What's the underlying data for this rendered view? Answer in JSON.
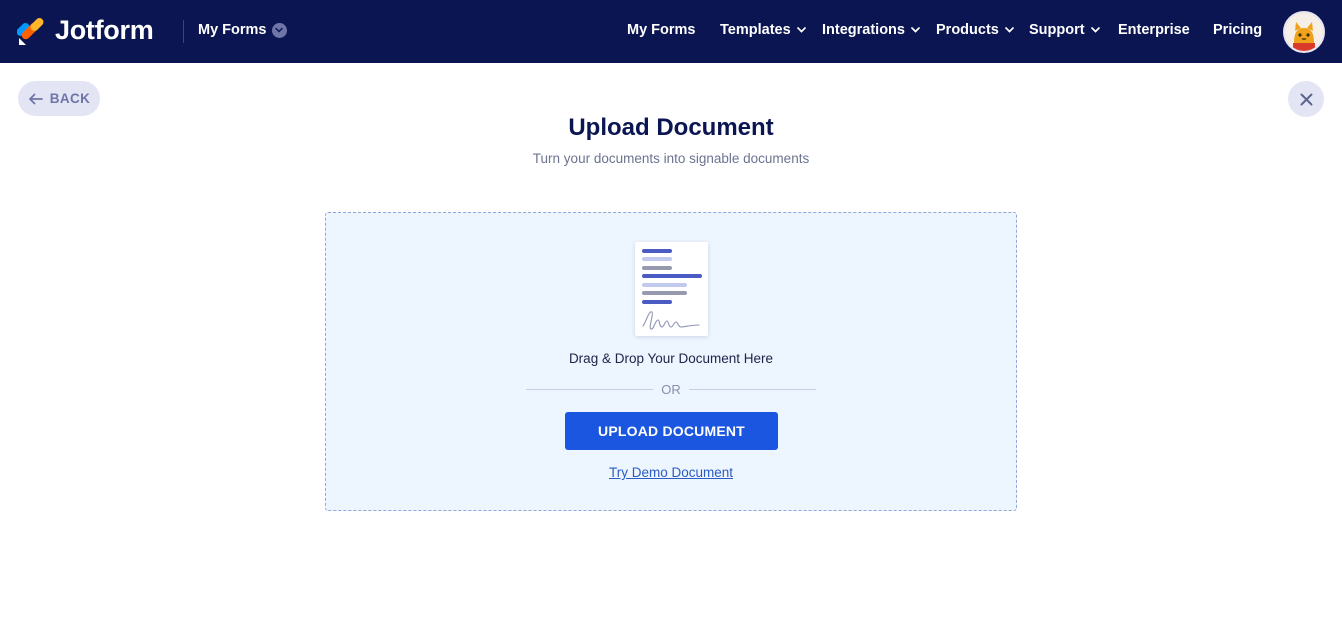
{
  "header": {
    "brand": "Jotform",
    "my_forms_dropdown": "My Forms",
    "nav": [
      {
        "label": "My Forms",
        "has_dropdown": false
      },
      {
        "label": "Templates",
        "has_dropdown": true
      },
      {
        "label": "Integrations",
        "has_dropdown": true
      },
      {
        "label": "Products",
        "has_dropdown": true
      },
      {
        "label": "Support",
        "has_dropdown": true
      },
      {
        "label": "Enterprise",
        "has_dropdown": false
      },
      {
        "label": "Pricing",
        "has_dropdown": false
      }
    ],
    "avatar_icon": "avatar-cat-icon"
  },
  "toolbar": {
    "back_label": "BACK",
    "close_icon": "close-icon"
  },
  "page": {
    "title": "Upload Document",
    "subtitle": "Turn your documents into signable documents"
  },
  "dropzone": {
    "instruction": "Drag & Drop Your Document Here",
    "separator": "OR",
    "upload_button": "UPLOAD DOCUMENT",
    "demo_link": "Try Demo Document",
    "illustration_icon": "signed-document-icon"
  },
  "colors": {
    "header_bg": "#0a1551",
    "primary_button": "#1b56e0",
    "dropzone_bg": "#edf5fe",
    "link": "#2b5cc4"
  }
}
